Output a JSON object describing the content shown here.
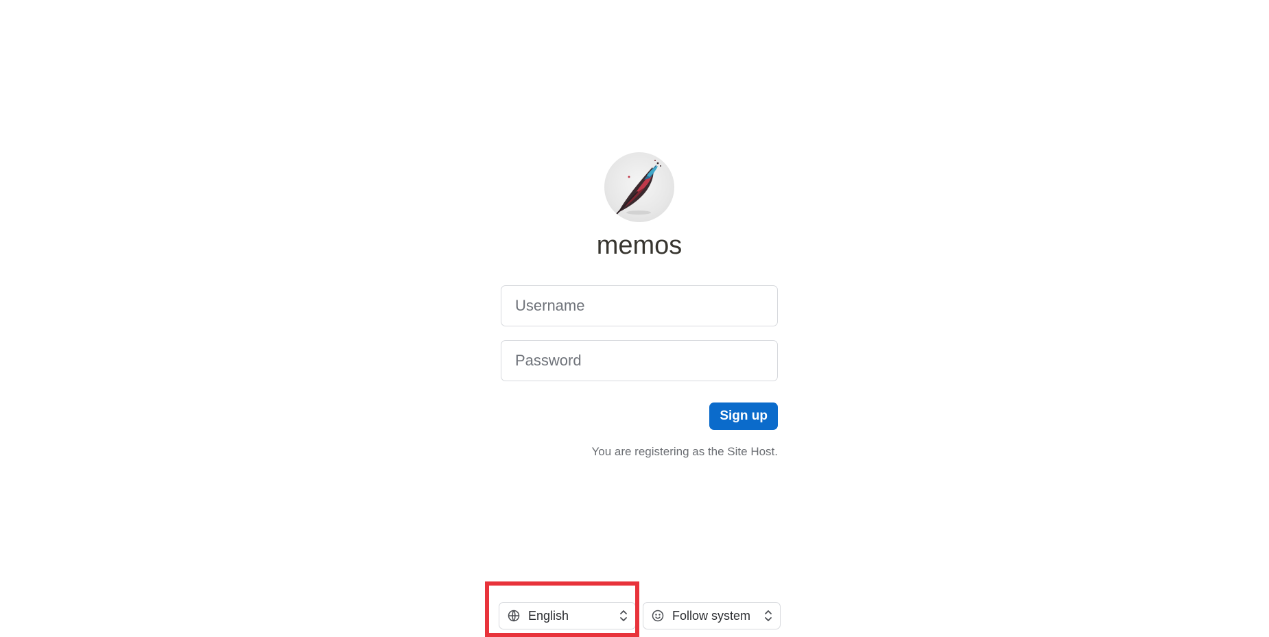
{
  "app": {
    "name": "memos",
    "logo_icon": "feather-quill-logo"
  },
  "form": {
    "username_placeholder": "Username",
    "username_value": "",
    "password_placeholder": "Password",
    "password_value": "",
    "signup_label": "Sign up",
    "note": "You are registering as the Site Host."
  },
  "footer": {
    "language": {
      "icon": "globe-icon",
      "value": "English"
    },
    "theme": {
      "icon": "smiley-icon",
      "value": "Follow system"
    }
  },
  "colors": {
    "primary": "#0b6bcb",
    "highlight": "#e8333b"
  }
}
